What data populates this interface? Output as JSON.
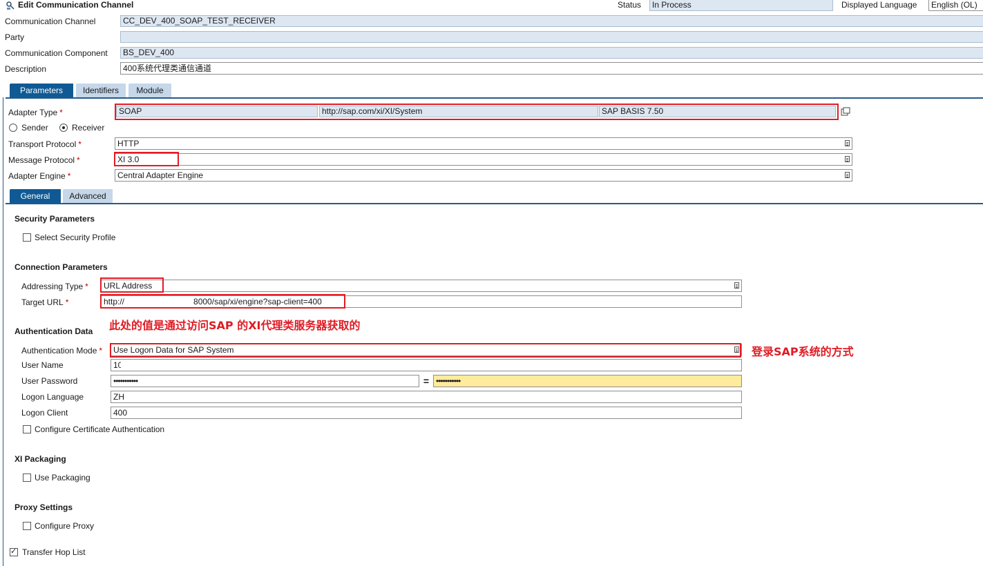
{
  "header": {
    "title": "Edit Communication Channel",
    "status_label": "Status",
    "status_value": "In Process",
    "language_label": "Displayed Language",
    "language_value": "English (OL)"
  },
  "channel": {
    "communication_channel_label": "Communication Channel",
    "communication_channel_value": "CC_DEV_400_SOAP_TEST_RECEIVER",
    "party_label": "Party",
    "party_value": "",
    "component_label": "Communication Component",
    "component_value": "BS_DEV_400",
    "description_label": "Description",
    "description_value": "400系统代理类通信通道"
  },
  "tabs_main": [
    "Parameters",
    "Identifiers",
    "Module"
  ],
  "parameters": {
    "adapter_type_label": "Adapter Type",
    "adapter_type": "SOAP",
    "adapter_namespace": "http://sap.com/xi/XI/System",
    "adapter_swcv": "SAP BASIS 7.50",
    "sender_label": "Sender",
    "receiver_label": "Receiver",
    "direction_selected": "Receiver",
    "transport_protocol_label": "Transport Protocol",
    "transport_protocol_value": "HTTP",
    "message_protocol_label": "Message Protocol",
    "message_protocol_value": "XI 3.0",
    "adapter_engine_label": "Adapter Engine",
    "adapter_engine_value": "Central Adapter Engine",
    "required_mark": "*"
  },
  "tabs_sub": [
    "General",
    "Advanced"
  ],
  "general": {
    "security_title": "Security Parameters",
    "select_security_profile": "Select Security Profile",
    "connection_title": "Connection Parameters",
    "addressing_type_label": "Addressing Type",
    "addressing_type_value": "URL Address",
    "target_url_label": "Target URL",
    "target_url_value": "http://                              8000/sap/xi/engine?sap-client=400",
    "annotation_url": "此处的值是通过访问SAP 的XI代理类服务器获取的",
    "auth_title": "Authentication Data",
    "auth_mode_label": "Authentication Mode",
    "auth_mode_value": "Use Logon Data for SAP System",
    "annotation_auth": "登录SAP系统的方式",
    "user_name_label": "User Name",
    "user_name_value": "10",
    "user_password_label": "User Password",
    "password_mask": "•••••••••••",
    "equals_sign": "=",
    "logon_language_label": "Logon Language",
    "logon_language_value": "ZH",
    "logon_client_label": "Logon Client",
    "logon_client_value": "400",
    "cert_auth_label": "Configure Certificate Authentication",
    "xi_packaging_title": "XI Packaging",
    "use_packaging_label": "Use Packaging",
    "proxy_title": "Proxy Settings",
    "configure_proxy_label": "Configure Proxy",
    "transfer_hop_list_label": "Transfer Hop List"
  },
  "colors": {
    "accent": "#0f5a94",
    "highlight_box": "#e01b24",
    "readonly_field": "#dde7f1",
    "password_confirm": "#ffeb9c"
  }
}
